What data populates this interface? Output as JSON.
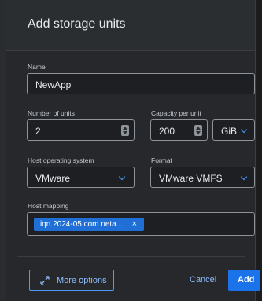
{
  "dialog": {
    "title": "Add storage units"
  },
  "form": {
    "name": {
      "label": "Name",
      "value": "NewApp"
    },
    "units": {
      "label": "Number of units",
      "value": "2"
    },
    "capacity": {
      "label": "Capacity per unit",
      "value": "200",
      "unit": "GiB"
    },
    "host_os": {
      "label": "Host operating system",
      "value": "VMware"
    },
    "format": {
      "label": "Format",
      "value": "VMware VMFS"
    },
    "host_mapping": {
      "label": "Host mapping",
      "tag": "iqn.2024-05.com.neta...",
      "remove": "×"
    }
  },
  "footer": {
    "more_options": "More options",
    "cancel": "Cancel",
    "add": "Add"
  },
  "colors": {
    "accent": "#1a73e8",
    "link": "#8ebfff",
    "background": "#26282b"
  }
}
